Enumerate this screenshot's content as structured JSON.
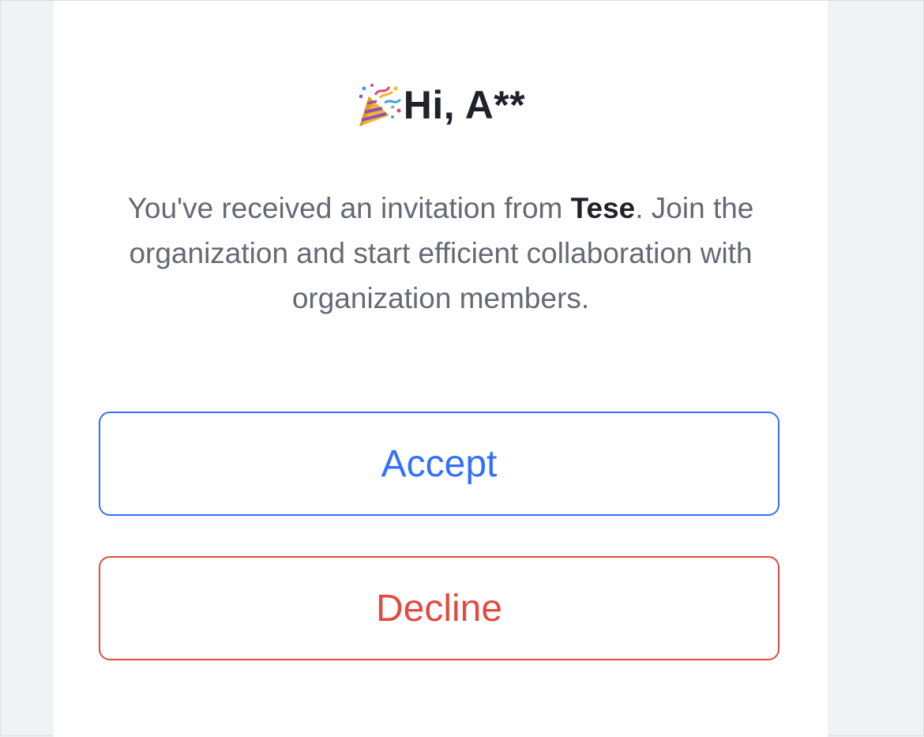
{
  "greeting": {
    "icon": "party-popper-icon",
    "text": "Hi, A**"
  },
  "message": {
    "prefix": "You've received an invitation from ",
    "org_name": "Tese",
    "suffix": ". Join the organization and start efficient collaboration with organization members."
  },
  "actions": {
    "accept_label": "Accept",
    "decline_label": "Decline"
  },
  "colors": {
    "accept": "#3370ff",
    "decline": "#e04c41",
    "text_primary": "#1f2329",
    "text_secondary": "#646a73",
    "background": "#f1f2f4"
  }
}
